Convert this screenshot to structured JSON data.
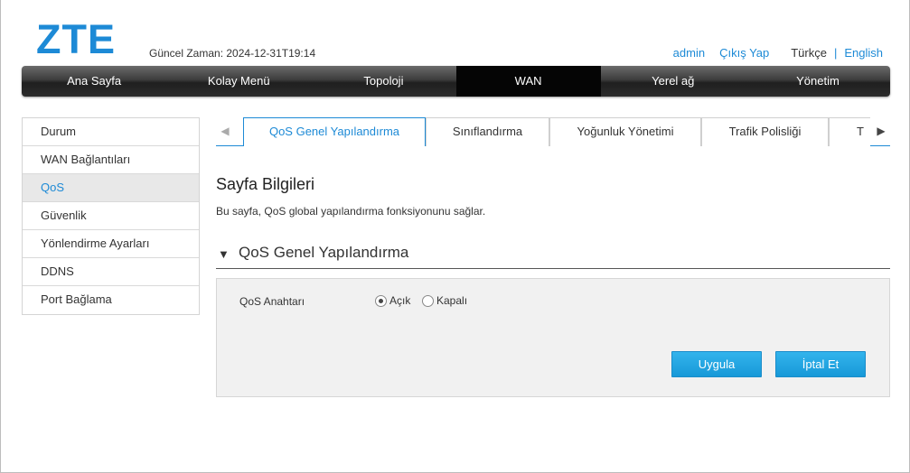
{
  "brand": {
    "logo_text": "ZTE",
    "color": "#1d8ad6"
  },
  "header": {
    "time_label": "Güncel Zaman: 2024-12-31T19:14",
    "user": "admin",
    "logout": "Çıkış Yap",
    "lang_current": "Türkçe",
    "lang_sep": "|",
    "lang_other": "English"
  },
  "nav": {
    "items": [
      "Ana Sayfa",
      "Kolay Menü",
      "Topoloji",
      "WAN",
      "Yerel ağ",
      "Yönetim"
    ],
    "active": "WAN"
  },
  "sidebar": {
    "items": [
      "Durum",
      "WAN Bağlantıları",
      "QoS",
      "Güvenlik",
      "Yönlendirme Ayarları",
      "DDNS",
      "Port Bağlama"
    ],
    "active": "QoS"
  },
  "tabs": {
    "items": [
      "QoS Genel Yapılandırma",
      "Sınıflandırma",
      "Yoğunluk Yönetimi",
      "Trafik Polisliği",
      "T"
    ],
    "active": "QoS Genel Yapılandırma",
    "left_arrow": "◀",
    "right_arrow": "▶"
  },
  "page": {
    "title": "Sayfa Bilgileri",
    "description": "Bu sayfa, QoS global yapılandırma fonksiyonunu sağlar."
  },
  "section": {
    "toggle_glyph": "▼",
    "title": "QoS Genel Yapılandırma"
  },
  "form": {
    "field_label": "QoS Anahtarı",
    "options": [
      "Açık",
      "Kapalı"
    ],
    "selected": "Açık",
    "apply_label": "Uygula",
    "cancel_label": "İptal Et"
  }
}
